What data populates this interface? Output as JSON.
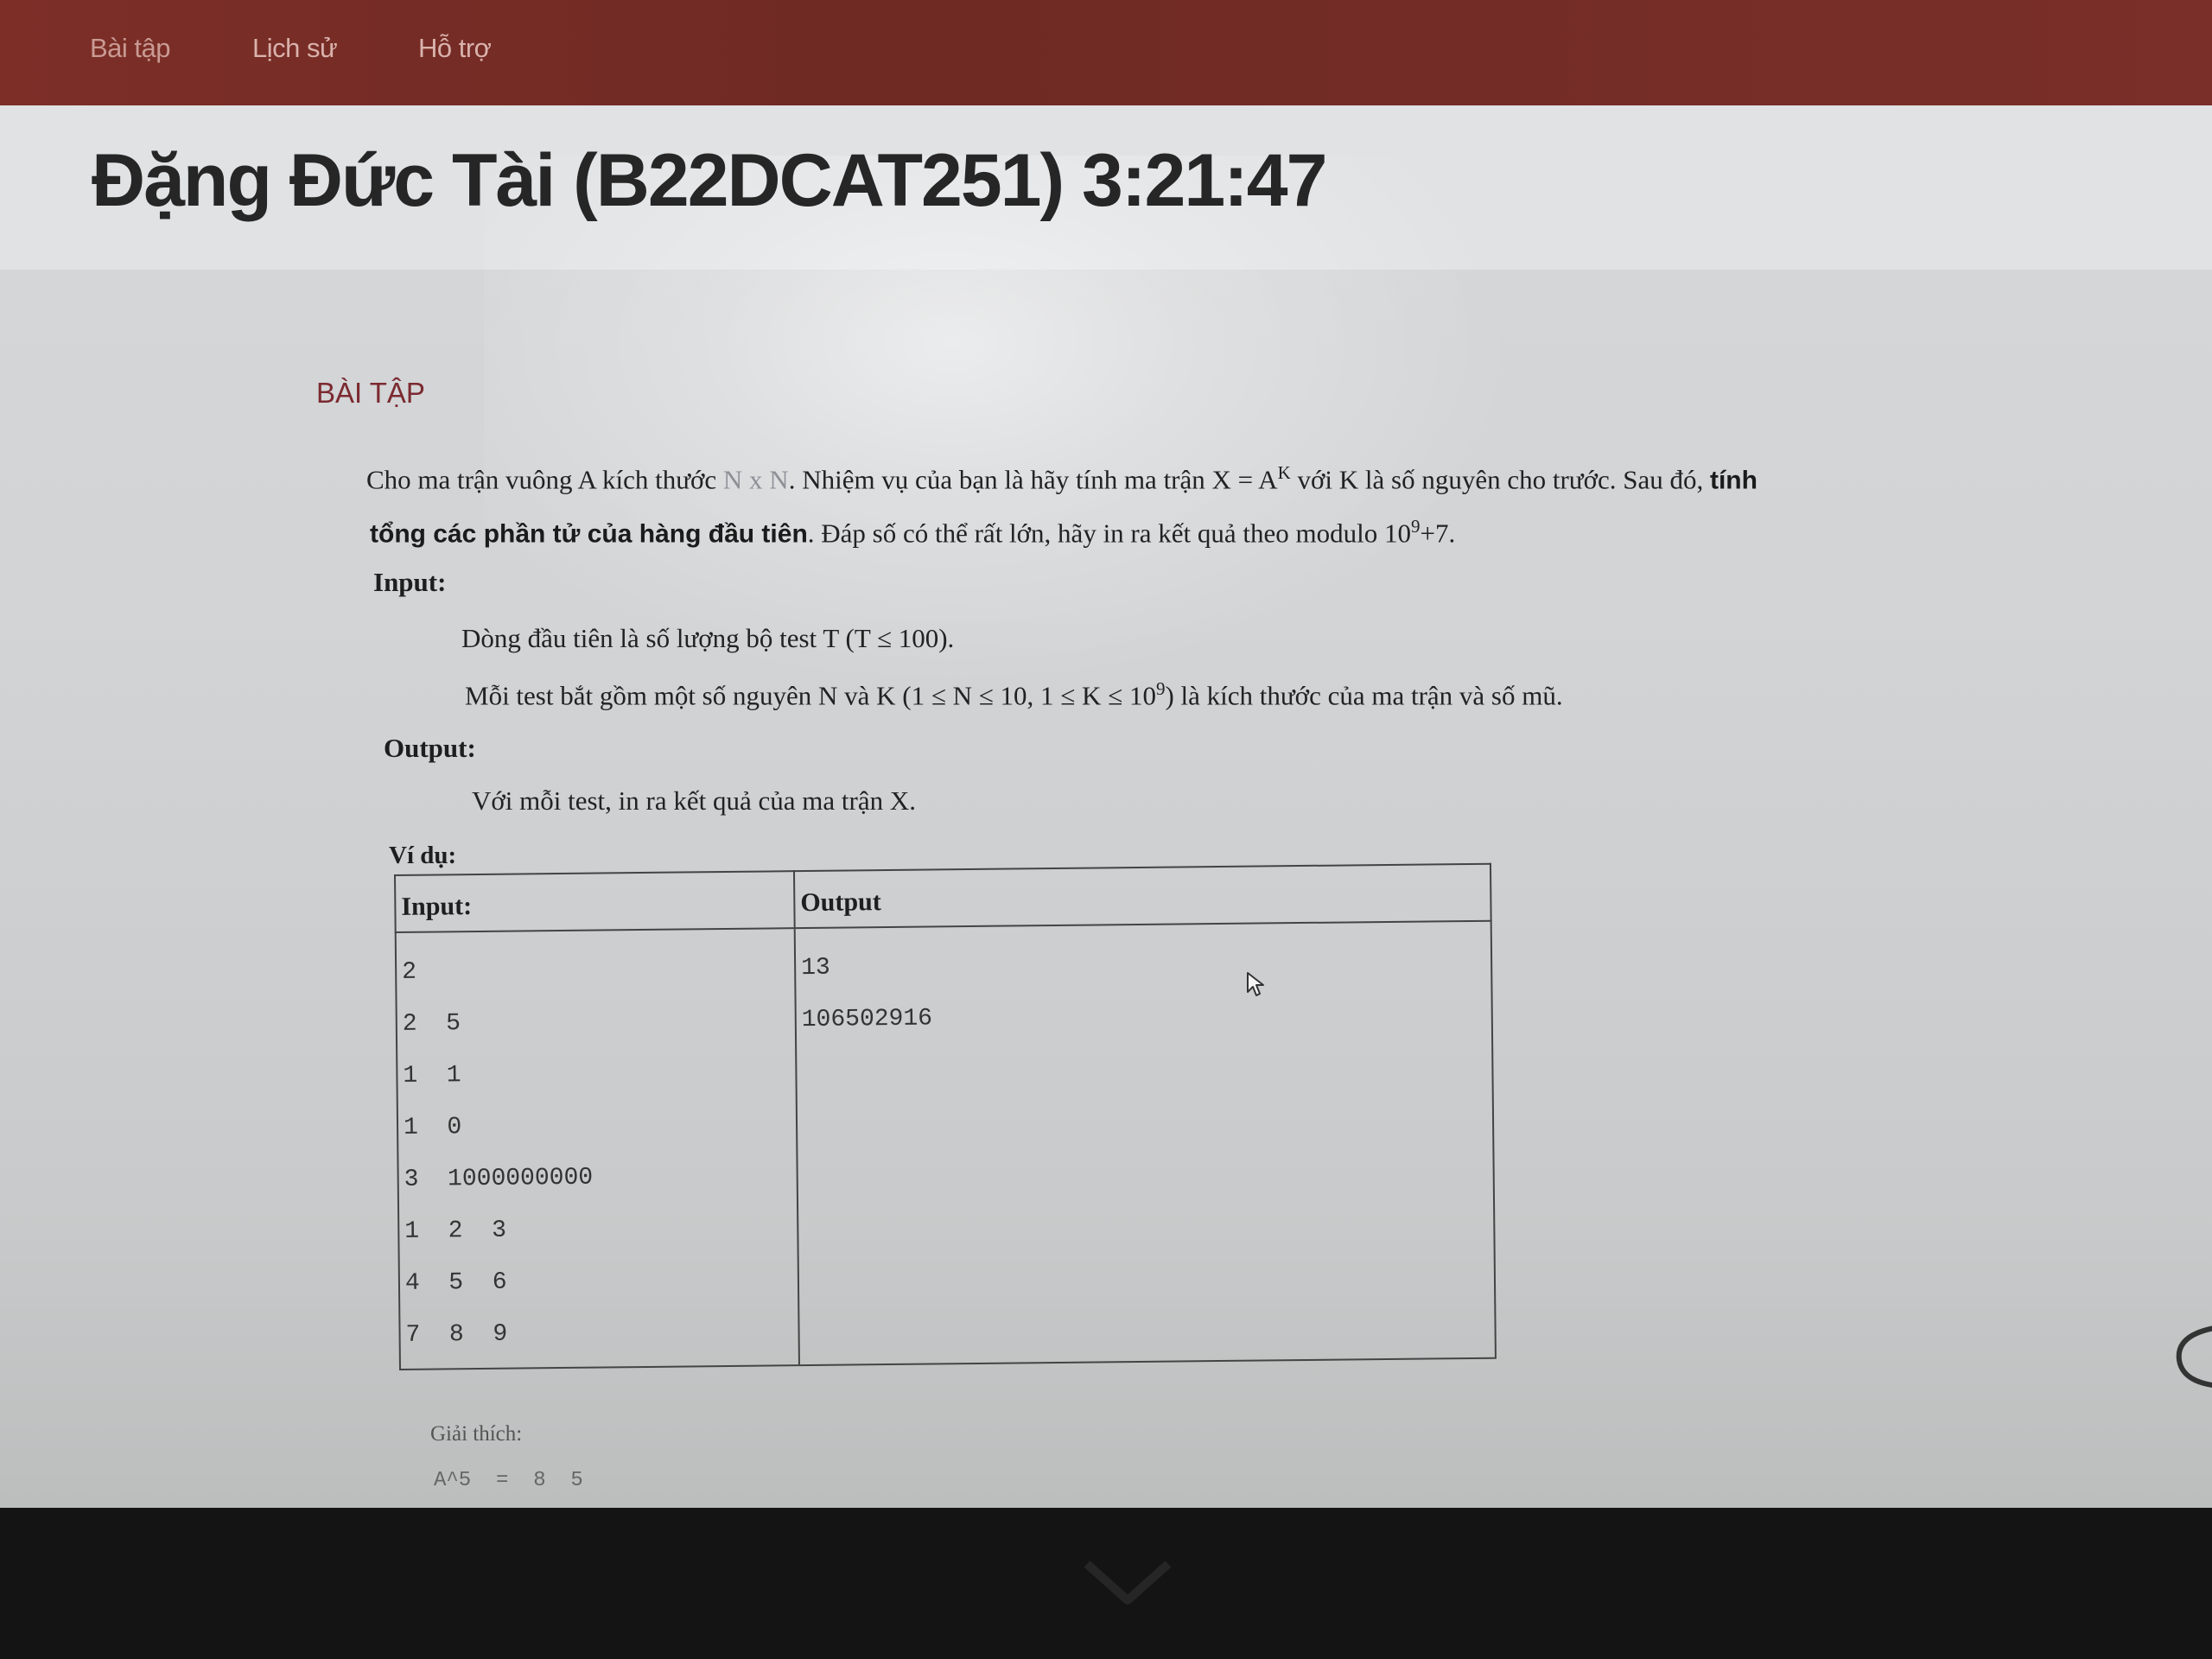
{
  "nav": {
    "items": [
      {
        "label": "Bài tập"
      },
      {
        "label": "Lịch sử"
      },
      {
        "label": "Hỗ trợ"
      }
    ]
  },
  "header": {
    "title": "Đặng Đức Tài (B22DCAT251) 3:21:47"
  },
  "section": {
    "title": "BÀI TẬP"
  },
  "problem": {
    "line1_a": "Cho ma trận vuông A kích thước ",
    "line1_faint": "N x N",
    "line1_b": ". Nhiệm vụ của bạn là hãy tính ma trận X = A",
    "line1_sup": "K",
    "line1_c": " với K là số nguyên cho trước. Sau đó, ",
    "line1_bold": "tính",
    "line2_bold": "tổng các phần tử của hàng đầu tiên",
    "line2_a": ". Đáp số có thể rất lớn, hãy in ra kết quả theo modulo 10",
    "line2_sup": "9",
    "line2_b": "+7.",
    "input_label": "Input:",
    "input_line1": "Dòng đầu tiên là số lượng bộ test T (T ≤ 100).",
    "input_line2_a": "Mỗi test bắt gồm một số nguyên N và K (1 ≤ N ≤ 10, 1 ≤ K ≤ 10",
    "input_line2_sup": "9",
    "input_line2_b": ") là kích thước của ma trận và số mũ.",
    "output_label": "Output:",
    "output_line": "Với mỗi test, in ra kết quả của ma trận X.",
    "example_label": "Ví dụ:"
  },
  "example_table": {
    "headers": [
      "Input:",
      "Output"
    ],
    "input_lines": [
      "2",
      "2  5",
      "1  1",
      "1  0",
      "3  1000000000",
      "1  2  3",
      "4  5  6",
      "7  8  9"
    ],
    "output_lines": [
      "13",
      "106502916"
    ]
  },
  "explanation": {
    "label": "Giải thích:",
    "line1": "A^5  =  8  5"
  }
}
